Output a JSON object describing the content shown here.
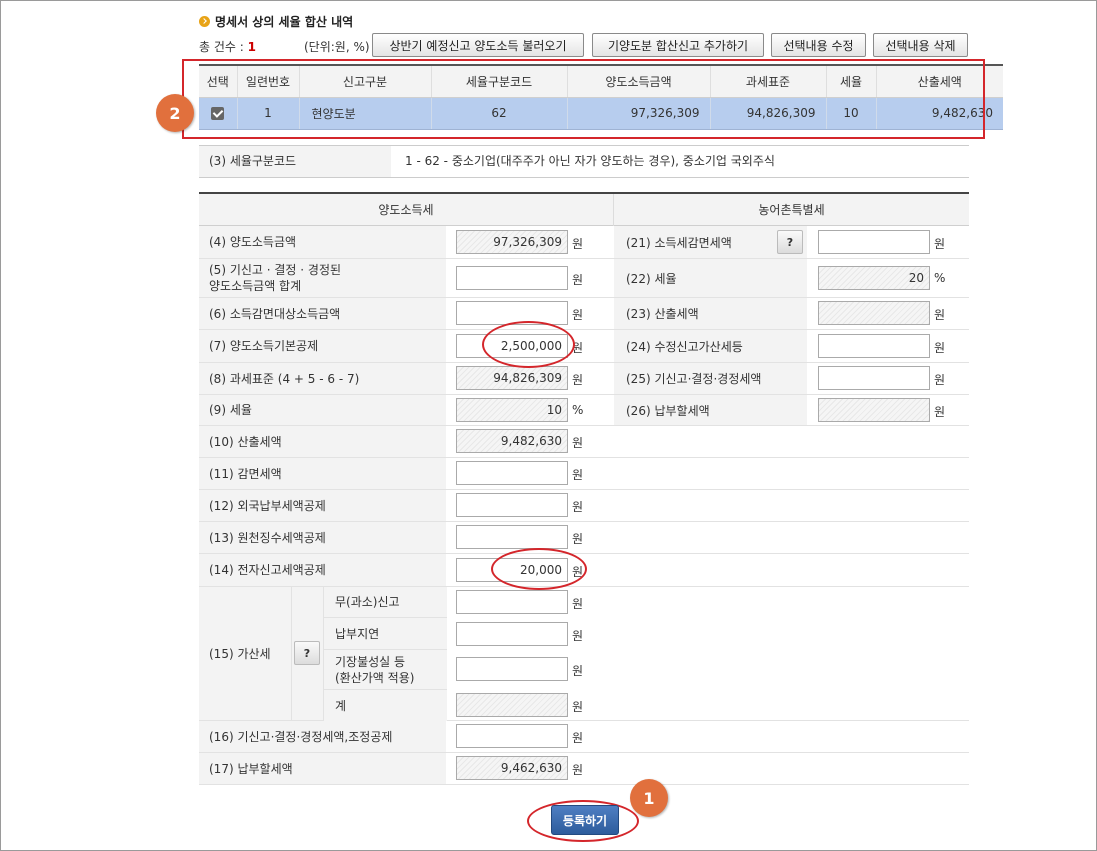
{
  "header": {
    "title": "명세서 상의 세율 합산 내역",
    "count_label": "총 건수 : ",
    "count_value": "1",
    "unit_note": "(단위:원, %)",
    "buttons": [
      "상반기 예정신고 양도소득 불러오기",
      "기양도분 합산신고 추가하기",
      "선택내용 수정",
      "선택내용 삭제"
    ]
  },
  "list_table": {
    "columns": [
      "선택",
      "일련번호",
      "신고구분",
      "세율구분코드",
      "양도소득금액",
      "과세표준",
      "세율",
      "산출세액"
    ],
    "rows": [
      {
        "selected": true,
        "serial": "1",
        "type": "현양도분",
        "code": "62",
        "income": "97,326,309",
        "base": "94,826,309",
        "rate": "10",
        "tax": "9,482,630"
      }
    ]
  },
  "annotations": {
    "badge_1": "1",
    "badge_2": "2"
  },
  "tax_code": {
    "label": "(3) 세율구분코드",
    "value": "1  -  62  -  중소기업(대주주가 아닌 자가 양도하는 경우), 중소기업 국외주식"
  },
  "form": {
    "left_header": "양도소득세",
    "right_header": "농어촌특별세",
    "unit_won": "원",
    "unit_pct": "%",
    "help": "?",
    "left_rows": [
      {
        "label": "(4) 양도소득금액",
        "value": "97,326,309",
        "readonly": true
      },
      {
        "label": "(5) 기신고 · 결정 · 경정된\n양도소득금액 합계",
        "value": "",
        "readonly": false
      },
      {
        "label": "(6) 소득감면대상소득금액",
        "value": "",
        "readonly": false
      },
      {
        "label": "(7) 양도소득기본공제",
        "value": "2,500,000",
        "readonly": false
      },
      {
        "label": "(8) 과세표준 (4 + 5 - 6 - 7)",
        "value": "94,826,309",
        "readonly": true
      },
      {
        "label": "(9) 세율",
        "value": "10",
        "readonly": true
      },
      {
        "label": "(10) 산출세액",
        "value": "9,482,630",
        "readonly": true
      },
      {
        "label": "(11) 감면세액",
        "value": "",
        "readonly": false
      },
      {
        "label": "(12) 외국납부세액공제",
        "value": "",
        "readonly": false
      },
      {
        "label": "(13) 원천징수세액공제",
        "value": "",
        "readonly": false
      },
      {
        "label": "(14) 전자신고세액공제",
        "value": "20,000",
        "readonly": false
      }
    ],
    "penalty": {
      "label": "(15) 가산세",
      "items": [
        {
          "label": "무(과소)신고",
          "value": "",
          "readonly": false
        },
        {
          "label": "납부지연",
          "value": "",
          "readonly": false
        },
        {
          "label": "기장불성실 등\n(환산가액 적용)",
          "value": "",
          "readonly": false
        },
        {
          "label": "계",
          "value": "",
          "readonly": true
        }
      ]
    },
    "bottom_rows": [
      {
        "label": "(16) 기신고·결정·경정세액,조정공제",
        "value": "",
        "readonly": false
      },
      {
        "label": "(17) 납부할세액",
        "value": "9,462,630",
        "readonly": true
      }
    ],
    "right_rows": [
      {
        "label": "(21) 소득세감면세액",
        "value": "",
        "readonly": false
      },
      {
        "label": "(22) 세율",
        "value": "20",
        "readonly": true
      },
      {
        "label": "(23) 산출세액",
        "value": "",
        "readonly": true
      },
      {
        "label": "(24) 수정신고가산세등",
        "value": "",
        "readonly": false
      },
      {
        "label": "(25) 기신고·결정·경정세액",
        "value": "",
        "readonly": false
      },
      {
        "label": "(26) 납부할세액",
        "value": "",
        "readonly": true
      }
    ]
  },
  "submit_label": "등록하기",
  "colors": {
    "accent_red": "#d4262b",
    "badge": "#e1703d",
    "selected_row": "#b7cdee",
    "submit_blue": "#2d5c9c"
  }
}
